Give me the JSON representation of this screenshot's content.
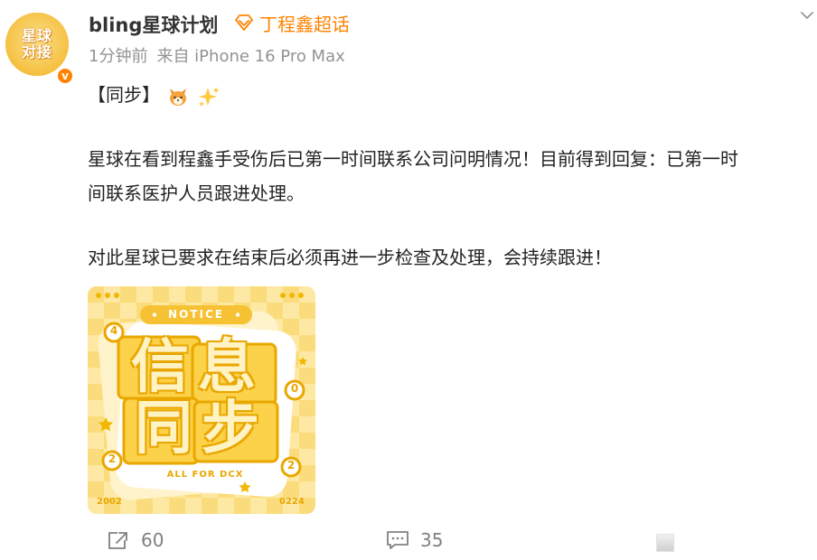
{
  "post": {
    "author": "bling星球计划",
    "avatar_text_line1": "星球",
    "avatar_text_line2": "对接",
    "verified_badge": "v",
    "supertopic": "丁程鑫超话",
    "time": "1分钟前",
    "source": "来自 iPhone 16 Pro Max",
    "tag_line": "【同步】",
    "paragraph1_line1": "星球在看到程鑫手受伤后已第一时间联系公司问明情况！目前得到回复：已第一时",
    "paragraph1_line2": "间联系医护人员跟进处理。",
    "paragraph2": "对此星球已要求在结束后必须再进一步检查及处理，会持续跟进！"
  },
  "image": {
    "badge": "NOTICE",
    "title_line1": "信息",
    "title_line2": "同步",
    "subtitle": "ALL FOR DCX",
    "year_left": "2002",
    "date_right": "0224",
    "digit_top_left": "4",
    "digit_mid_right": "0",
    "digit_bottom_left": "2",
    "digit_bottom_right": "2"
  },
  "actions": {
    "repost_count": "60",
    "comment_count": "35"
  },
  "icons": [
    "chevron-down-icon",
    "supertopic-diamond-icon",
    "fox-emoji-icon",
    "sparkles-emoji-icon",
    "repost-icon",
    "comment-icon",
    "like-icon"
  ],
  "colors": {
    "accent": "#ff8200",
    "meta": "#939393",
    "notice_bg": "#fde9a4",
    "notice_gold": "#f2b705"
  }
}
